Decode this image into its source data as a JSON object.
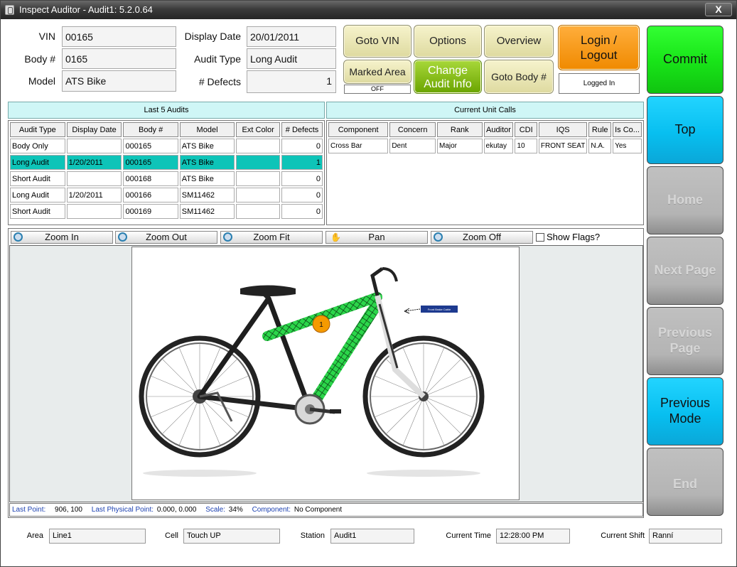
{
  "window": {
    "title": "Inspect Auditor - Audit1: 5.2.0.64",
    "close": "X"
  },
  "fields": {
    "vin_label": "VIN",
    "vin": "00165",
    "body_label": "Body #",
    "body": "0165",
    "model_label": "Model",
    "model": "ATS Bike",
    "display_date_label": "Display Date",
    "display_date": "20/01/2011",
    "audit_type_label": "Audit Type",
    "audit_type": "Long Audit",
    "defects_label": "# Defects",
    "defects": "1"
  },
  "buttons": {
    "goto_vin": "Goto VIN",
    "options": "Options",
    "overview": "Overview",
    "login": "Login /",
    "logout": "Logout",
    "marked_area": "Marked Area",
    "marked_area_state": "OFF",
    "change_audit_1": "Change",
    "change_audit_2": "Audit Info",
    "goto_body": "Goto Body #",
    "logged_in": "Logged In"
  },
  "side": {
    "commit": "Commit",
    "top": "Top",
    "home": "Home",
    "next_page": "Next Page",
    "prev_page_1": "Previous",
    "prev_page_2": "Page",
    "prev_mode_1": "Previous",
    "prev_mode_2": "Mode",
    "end": "End"
  },
  "last5": {
    "title": "Last 5 Audits",
    "headers": [
      "Audit Type",
      "Display Date",
      "Body #",
      "Model",
      "Ext Color",
      "# Defects"
    ],
    "rows": [
      [
        "Body Only",
        "",
        "000165",
        "ATS Bike",
        "",
        "0"
      ],
      [
        "Long Audit",
        "1/20/2011",
        "000165",
        "ATS Bike",
        "",
        "1"
      ],
      [
        "Short Audit",
        "",
        "000168",
        "ATS Bike",
        "",
        "0"
      ],
      [
        "Long Audit",
        "1/20/2011",
        "000166",
        "SM11462",
        "",
        "0"
      ],
      [
        "Short Audit",
        "",
        "000169",
        "SM11462",
        "",
        "0"
      ]
    ]
  },
  "calls": {
    "title": "Current Unit Calls",
    "headers": [
      "Component",
      "Concern",
      "Rank",
      "Auditor",
      "CDI",
      "IQS",
      "Rule",
      "Is Co..."
    ],
    "rows": [
      [
        "Cross Bar",
        "Dent",
        "Major",
        "ekutay",
        "10",
        "FRONT SEAT",
        "N.A.",
        "Yes"
      ]
    ]
  },
  "zoom": {
    "zoom_in": "Zoom In",
    "zoom_out": "Zoom Out",
    "zoom_fit": "Zoom Fit",
    "pan": "Pan",
    "zoom_off": "Zoom Off",
    "show_flags": "Show Flags?"
  },
  "image": {
    "marker": "1",
    "tag": "Front Brake Cable"
  },
  "status": {
    "last_point_label": "Last Point:",
    "last_point": "906,   100",
    "last_phys_label": "Last Physical Point:",
    "last_phys": "0.000, 0.000",
    "scale_label": "Scale:",
    "scale": "34%",
    "component_label": "Component:",
    "component": "No Component"
  },
  "footer": {
    "area_label": "Area",
    "area": "Line1",
    "cell_label": "Cell",
    "cell": "Touch UP",
    "station_label": "Station",
    "station": "Audit1",
    "time_label": "Current Time",
    "time": "12:28:00 PM",
    "shift_label": "Current Shift",
    "shift": "Ranní"
  },
  "colors": {
    "commit": "#19e619",
    "blue": "#08bff0",
    "selected_row": "#0ec4b8",
    "orange": "#f08a00",
    "highlight": "#22cc44"
  }
}
